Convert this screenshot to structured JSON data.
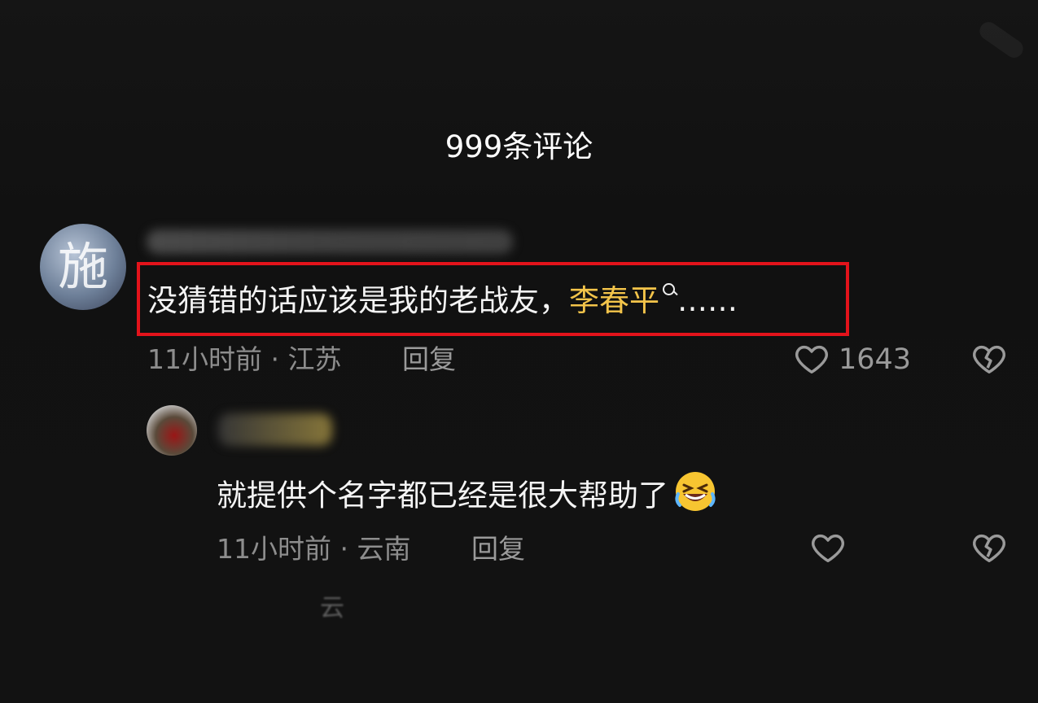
{
  "header": {
    "title": "999条评论"
  },
  "comment": {
    "text_before": "没猜错的话应该是我的老战友，",
    "keyword": "李春平",
    "text_after": "……",
    "meta": "11小时前 · 江苏",
    "reply_label": "回复",
    "like_count": "1643"
  },
  "reply": {
    "text": "就提供个名字都已经是很大帮助了",
    "emoji": "rolling-on-floor-laughing",
    "meta": "11小时前 · 云南",
    "reply_label": "回复"
  },
  "more": {
    "text": "云"
  },
  "colors": {
    "background": "#111111",
    "keyword": "#f3c44a",
    "highlight_border": "#e3131b",
    "meta_text": "#8d8d8d"
  },
  "icons": [
    "heart-icon",
    "broken-heart-icon",
    "search-icon"
  ]
}
